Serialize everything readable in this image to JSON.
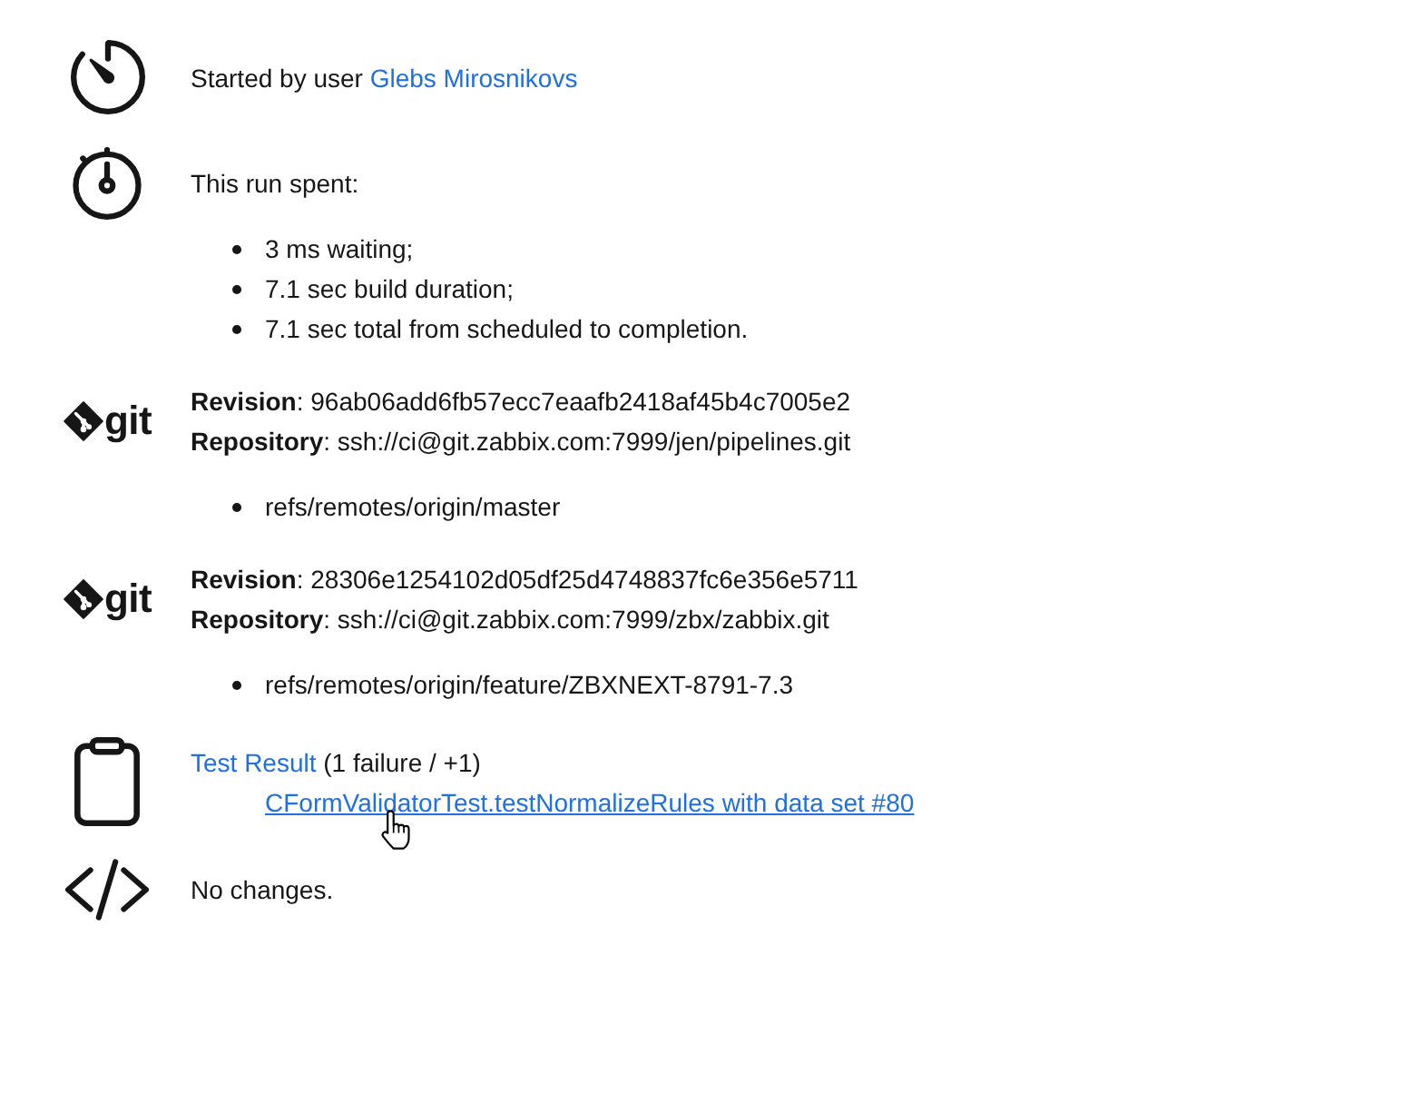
{
  "entries": [
    {
      "kind": "timer",
      "parts": [
        {
          "kind": "text",
          "text": "Started by user"
        },
        {
          "kind": "link",
          "text": "Glebs Mirosnikovs"
        }
      ]
    },
    {
      "kind": "stopwatch",
      "parts": [
        {
          "kind": "text",
          "text": "This run spent:"
        }
      ],
      "items": [
        "3 ms waiting;",
        "7.1 sec build duration;",
        "7.1 sec total from scheduled to completion."
      ]
    },
    {
      "kind": "git",
      "logo": "git",
      "lines": [
        "**Revision**: 96ab06add6fb57ecc7eaafb2418af45b4c7005e2",
        "**Repository**: ssh://ci@git.zabbix.com:7999/jen/pipelines.git"
      ],
      "items": [
        "refs/remotes/origin/master"
      ]
    },
    {
      "kind": "git",
      "logo": "git",
      "lines": [
        "**Revision**: 28306e1254102d05df25d4748837fc6e356e5711",
        "**Repository**: ssh://ci@git.zabbix.com:7999/zbx/zabbix.git"
      ],
      "items": [
        "refs/remotes/origin/feature/ZBXNEXT-8791-7.3"
      ]
    },
    {
      "kind": "tests",
      "parts": [
        {
          "kind": "link",
          "text": "Test Result"
        },
        {
          "kind": "text",
          "text": "(1 failure / +1)"
        }
      ],
      "sublinks": [
        {
          "text": "CFormValidatorTest.testNormalizeRules with data set #80",
          "hovered": true
        }
      ]
    },
    {
      "kind": "changes",
      "parts": [
        {
          "kind": "text",
          "text": "No changes."
        }
      ]
    }
  ]
}
